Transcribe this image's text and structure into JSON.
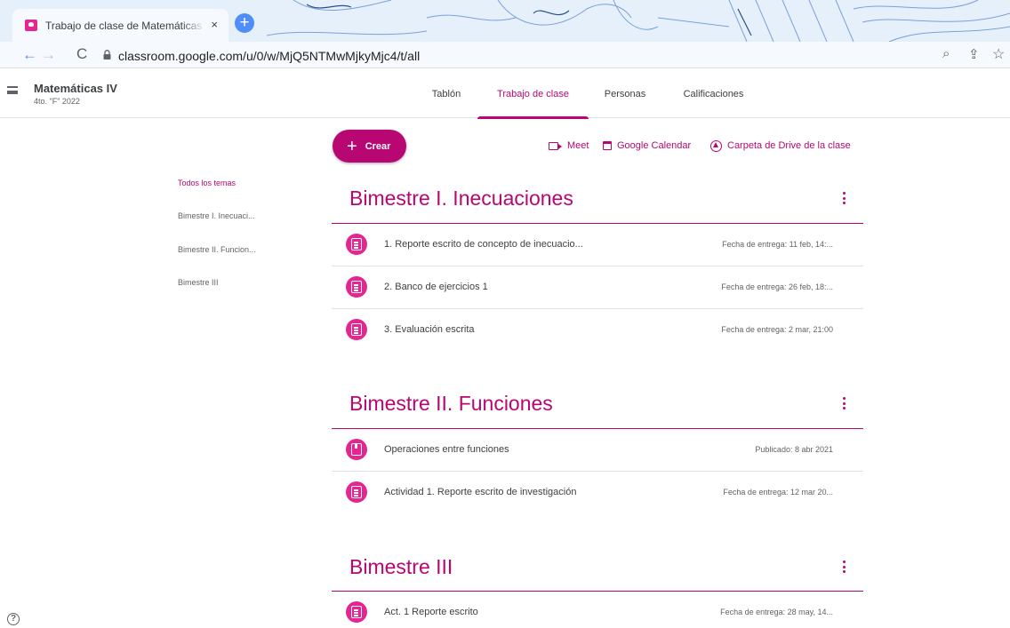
{
  "browser": {
    "tab_title": "Trabajo de clase de Matemáticas IV",
    "tab_close": "×",
    "new_tab": "+",
    "url": "classroom.google.com/u/0/w/MjQ5NTMwMjkyMjc4/t/all",
    "back": "←",
    "forward": "→",
    "reload": "C",
    "zoom": "⌕",
    "share": "⇪",
    "bookmark": "☆"
  },
  "course": {
    "title": "Matemáticas IV",
    "section": "4to. \"F\" 2022"
  },
  "tabs": [
    {
      "label": "Tablón"
    },
    {
      "label": "Trabajo de clase"
    },
    {
      "label": "Personas"
    },
    {
      "label": "Calificaciones"
    }
  ],
  "toolbar": {
    "create_label": "Crear",
    "create_plus": "+",
    "meet_label": "Meet",
    "calendar_label": "Google Calendar",
    "drive_label": "Carpeta de Drive de la clase"
  },
  "topics_nav": {
    "all": "Todos los temas",
    "items": [
      "Bimestre I. Inecuaci...",
      "Bimestre II. Funcion...",
      "Bimestre III"
    ]
  },
  "sections": [
    {
      "title": "Bimestre I. Inecuaciones",
      "items": [
        {
          "title": "1. Reporte escrito de concepto de inecuacio...",
          "meta": "Fecha de entrega: 11 feb, 14:...",
          "icon": "assignment-icon"
        },
        {
          "title": "2. Banco de ejercicios 1",
          "meta": "Fecha de entrega: 26 feb, 18:...",
          "icon": "assignment-icon"
        },
        {
          "title": "3. Evaluación escrita",
          "meta": "Fecha de entrega: 2 mar, 21:00",
          "icon": "assignment-icon"
        }
      ]
    },
    {
      "title": "Bimestre II. Funciones",
      "items": [
        {
          "title": "Operaciones entre funciones",
          "meta": "Publicado: 8 abr 2021",
          "icon": "material-icon"
        },
        {
          "title": "Actividad 1. Reporte escrito de investigación",
          "meta": "Fecha de entrega: 12 mar 20...",
          "icon": "assignment-icon"
        }
      ]
    },
    {
      "title": "Bimestre III",
      "items": [
        {
          "title": "Act. 1 Reporte escrito",
          "meta": "Fecha de entrega: 28 may, 14...",
          "icon": "assignment-icon"
        }
      ]
    }
  ],
  "help_glyph": "?",
  "colors": {
    "accent": "#b80672",
    "icon_bg": "#e52592",
    "browser_accent": "#4f8ef7"
  }
}
